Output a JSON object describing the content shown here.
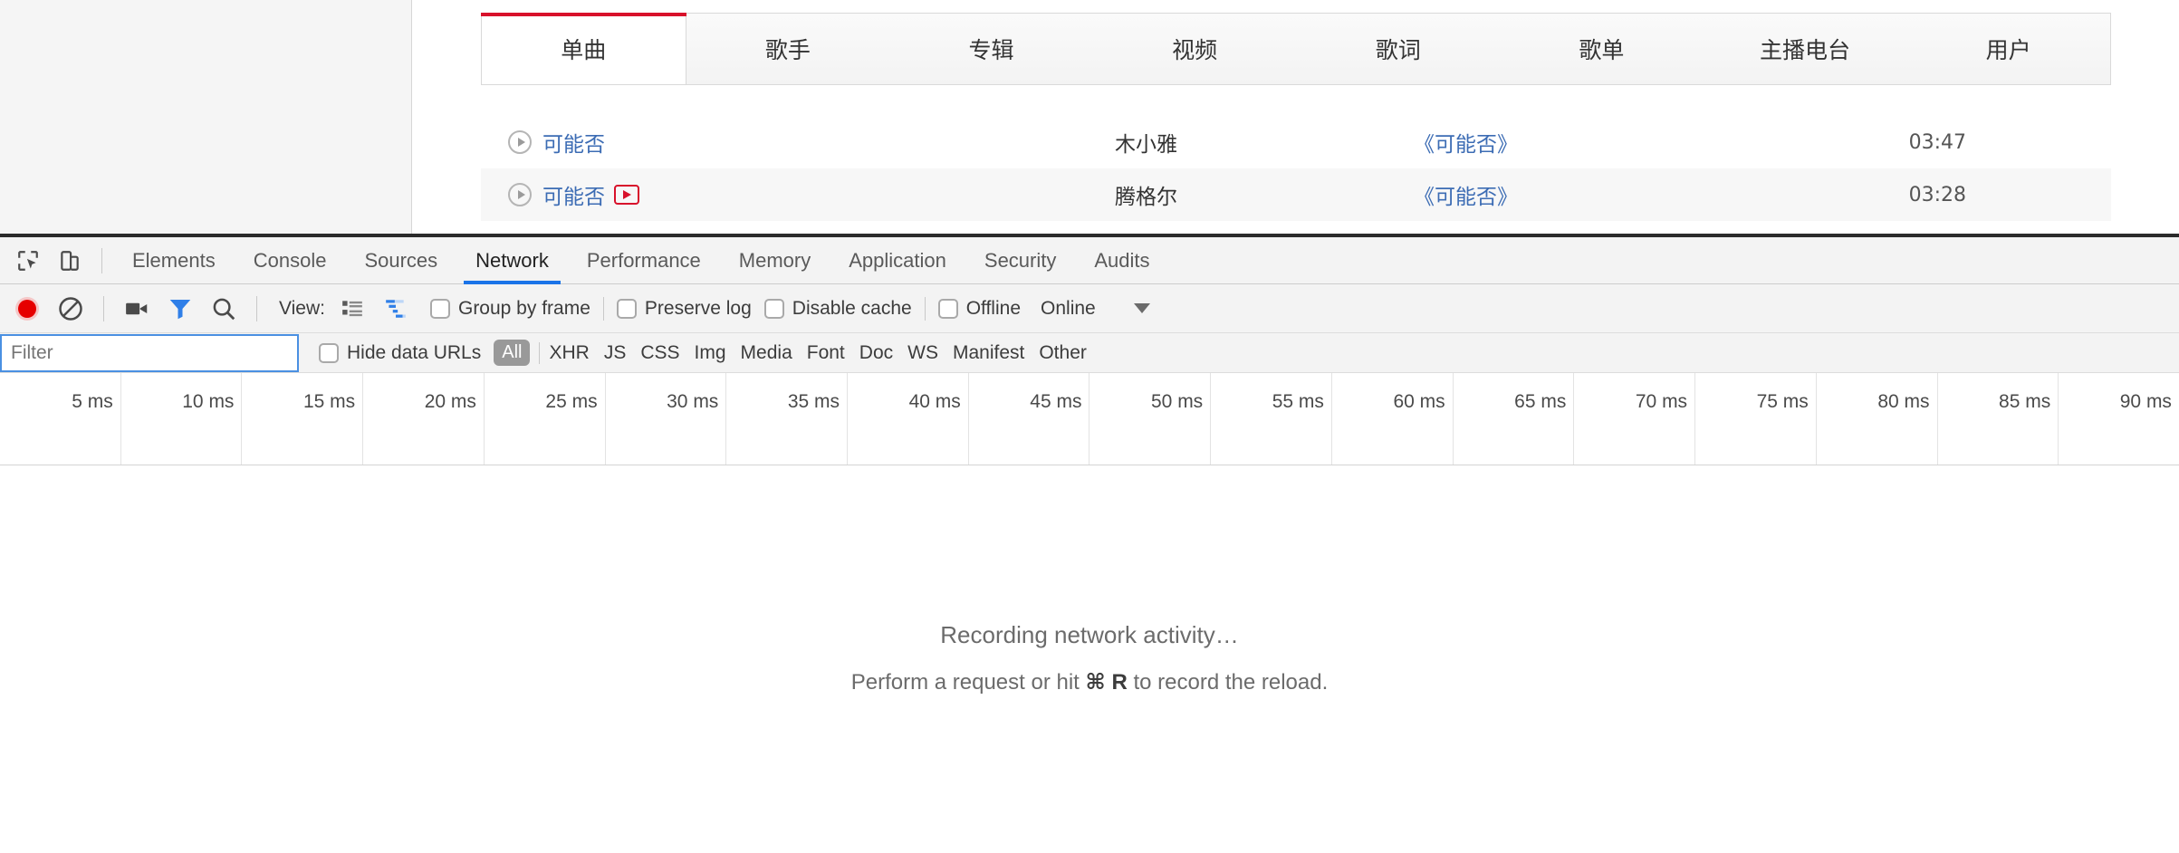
{
  "page": {
    "tabs": [
      {
        "label": "单曲",
        "active": true
      },
      {
        "label": "歌手",
        "active": false
      },
      {
        "label": "专辑",
        "active": false
      },
      {
        "label": "视频",
        "active": false
      },
      {
        "label": "歌词",
        "active": false
      },
      {
        "label": "歌单",
        "active": false
      },
      {
        "label": "主播电台",
        "active": false
      },
      {
        "label": "用户",
        "active": false
      }
    ],
    "songs": [
      {
        "title": "可能否",
        "artist": "木小雅",
        "album": "《可能否》",
        "duration": "03:47",
        "mv": false
      },
      {
        "title": "可能否",
        "artist": "腾格尔",
        "album": "《可能否》",
        "duration": "03:28",
        "mv": true
      }
    ],
    "accent_color": "#d8112b",
    "link_color": "#3c6cb4"
  },
  "devtools": {
    "panel_tabs": [
      {
        "label": "Elements",
        "active": false
      },
      {
        "label": "Console",
        "active": false
      },
      {
        "label": "Sources",
        "active": false
      },
      {
        "label": "Network",
        "active": true
      },
      {
        "label": "Performance",
        "active": false
      },
      {
        "label": "Memory",
        "active": false
      },
      {
        "label": "Application",
        "active": false
      },
      {
        "label": "Security",
        "active": false
      },
      {
        "label": "Audits",
        "active": false
      }
    ],
    "left_icons": [
      {
        "name": "inspect-element-icon"
      },
      {
        "name": "device-toolbar-icon"
      }
    ],
    "controlbar": {
      "record_icon": "record-icon",
      "clear_icon": "clear-icon",
      "screenshot_icon": "camera-icon",
      "filter_icon": "filter-funnel-icon",
      "search_icon": "search-icon",
      "view_label": "View:",
      "view_list_icon": "list-view-icon",
      "view_waterfall_icon": "waterfall-view-icon",
      "group_by_frame": "Group by frame",
      "preserve_log": "Preserve log",
      "disable_cache": "Disable cache",
      "offline": "Offline",
      "throttling": "Online",
      "throttling_caret": "chevron-down-icon"
    },
    "filterbar": {
      "filter_placeholder": "Filter",
      "filter_value": "",
      "hide_data_urls": "Hide data URLs",
      "types": [
        "All",
        "XHR",
        "JS",
        "CSS",
        "Img",
        "Media",
        "Font",
        "Doc",
        "WS",
        "Manifest",
        "Other"
      ],
      "selected_type": "All"
    },
    "ruler": {
      "ticks": [
        "5 ms",
        "10 ms",
        "15 ms",
        "20 ms",
        "25 ms",
        "30 ms",
        "35 ms",
        "40 ms",
        "45 ms",
        "50 ms",
        "55 ms",
        "60 ms",
        "65 ms",
        "70 ms",
        "75 ms",
        "80 ms",
        "85 ms",
        "90 ms"
      ]
    },
    "empty_state": {
      "line1": "Recording network activity…",
      "line2_prefix": "Perform a request or hit ",
      "line2_key": "⌘ R",
      "line2_suffix": " to record the reload."
    },
    "accent_color": "#1a73e8"
  }
}
